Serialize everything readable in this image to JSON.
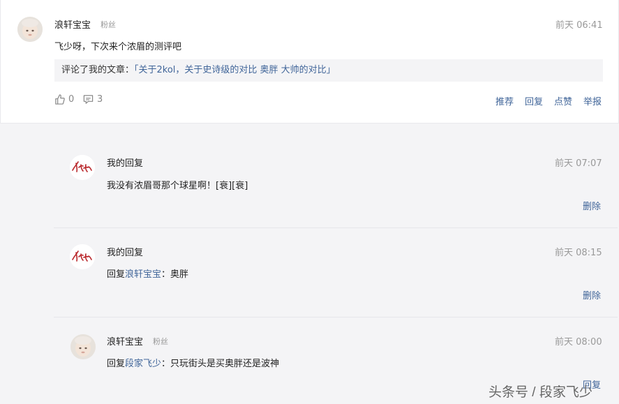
{
  "comment": {
    "author": "浪轩宝宝",
    "badge": "粉丝",
    "time": "前天 06:41",
    "content": "飞少呀，下次来个浓眉的测评吧",
    "quote_prefix": "评论了我的文章：",
    "quote_link": "「关于2kol，关于史诗级的对比 奥胖 大帅的对比」",
    "likes": "0",
    "replies": "3",
    "actions": [
      "推荐",
      "回复",
      "点赞",
      "举报"
    ]
  },
  "replies": [
    {
      "author": "我的回复",
      "time": "前天 07:07",
      "content": "我没有浓眉哥那个球星啊！[衰][衰]",
      "action": "删除"
    },
    {
      "author": "我的回复",
      "time": "前天 08:15",
      "prefix": "回复",
      "mention": "浪轩宝宝",
      "content": "：奥胖",
      "action": "删除"
    },
    {
      "author": "浪轩宝宝",
      "badge": "粉丝",
      "time": "前天 08:00",
      "prefix": "回复",
      "mention": "段家飞少",
      "content": "：只玩街头是买奥胖还是波神",
      "action": "回复"
    }
  ],
  "watermark": "头条号 / 段家飞少",
  "colors": {
    "link": "#406599",
    "muted": "#999999",
    "panel": "#f4f4f6"
  }
}
